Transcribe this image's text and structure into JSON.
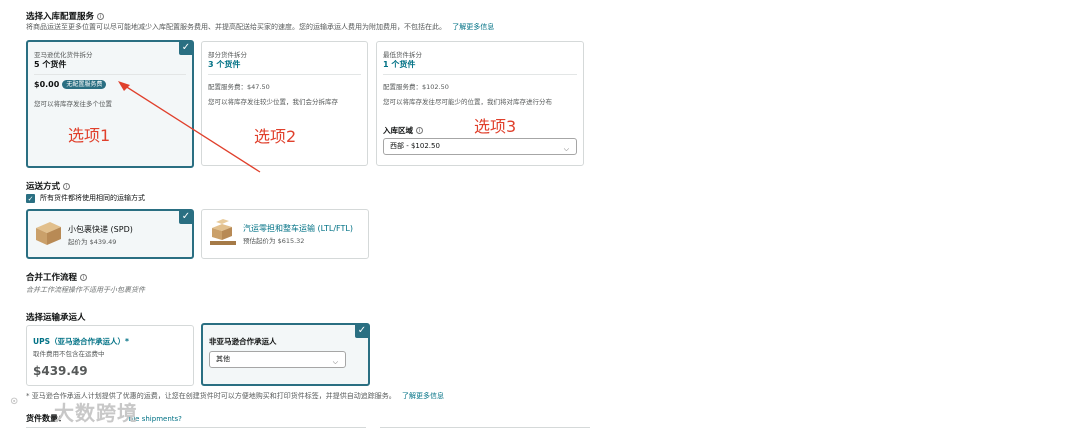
{
  "placement": {
    "title": "选择入库配置服务",
    "description": "将商品运送至更多位置可以尽可能地减少入库配置服务费用、并提高配送给买家的速度。您的运输承运人费用为附加费用，不包括在此。",
    "learn_more": "了解更多信息",
    "options": [
      {
        "name": "亚马逊优化货件拆分",
        "count": "5 个货件",
        "price": "$0.00",
        "badge": "无配置服务费",
        "desc": "您可以将库存发往多个位置",
        "annotation": "选项1"
      },
      {
        "name": "部分货件拆分",
        "count": "3 个货件",
        "fee": "配置服务费：$47.50",
        "desc": "您可以将库存发往较少位置，我们会分拆库存",
        "annotation": "选项2"
      },
      {
        "name": "最低货件拆分",
        "count": "1 个货件",
        "fee": "配置服务费：$102.50",
        "desc": "您可以将库存发往尽可能少的位置，我们将对库存进行分布",
        "annotation": "选项3",
        "region_label": "入库区域",
        "region_value": "西部 - $102.50"
      }
    ]
  },
  "shipping_mode": {
    "title": "运送方式",
    "checkbox_label": "所有货件都将使用相同的运输方式",
    "options": [
      {
        "name": "小包裹快递 (SPD)",
        "price": "起价为 $439.49"
      },
      {
        "name": "汽运零担和整车运输 (LTL/FTL)",
        "price": "预估起价为 $615.32"
      }
    ]
  },
  "merge": {
    "title": "合并工作流程",
    "desc": "合并工作流程操作不适用于小包裹货件"
  },
  "carrier": {
    "title": "选择运输承运人",
    "ups": {
      "name": "UPS（亚马逊合作承运人）*",
      "note": "取件费用不包含在运费中",
      "price": "$439.49"
    },
    "non_partner": {
      "name": "非亚马逊合作承运人",
      "select_value": "其他"
    },
    "footnote": "* 亚马逊合作承运人计划提供了优惠的运费，让您在创建货件时可以方便地购买和打印货件标签，并提供自动追踪服务。",
    "footnote_link": "了解更多信息"
  },
  "bottom": {
    "label": "货件数量：",
    "link": "ble shipments?"
  },
  "watermark": "大数跨境",
  "icons": {
    "check": "checkmark-icon",
    "info": "info-icon",
    "chevron": "chevron-down-icon",
    "box": "package-box-icon",
    "pallet": "pallet-icon"
  },
  "colors": {
    "selected_border": "#2a6f82",
    "link": "#007185",
    "annotation_red": "#e0402c"
  }
}
